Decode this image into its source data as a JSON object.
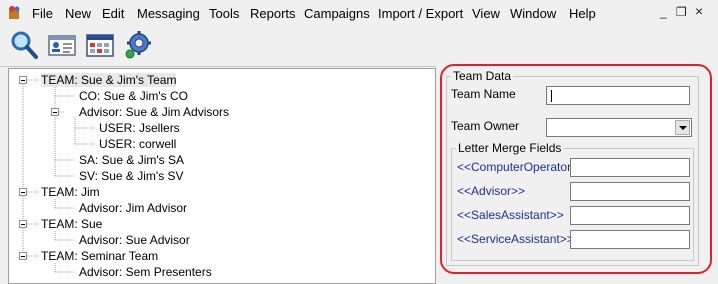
{
  "menubar": {
    "items": [
      "File",
      "New",
      "Edit",
      "Messaging",
      "Tools",
      "Reports",
      "Campaigns",
      "Import / Export",
      "View",
      "Window",
      "Help"
    ],
    "window_controls": {
      "minimize": "_",
      "restore": "❐",
      "close": "×"
    }
  },
  "toolbar": {
    "buttons": [
      "search-icon",
      "contact-card-icon",
      "calendar-grid-icon",
      "settings-gear-icon"
    ]
  },
  "tree": {
    "nodes": [
      {
        "label": "TEAM:  Sue & Jim's Team",
        "selected": true
      },
      {
        "label": "CO:  Sue & Jim's CO"
      },
      {
        "label": "Advisor:  Sue & Jim Advisors"
      },
      {
        "label": "USER:  Jsellers"
      },
      {
        "label": "USER:  corwell"
      },
      {
        "label": "SA:  Sue & Jim's SA"
      },
      {
        "label": "SV:  Sue & Jim's SV"
      },
      {
        "label": "TEAM:  Jim"
      },
      {
        "label": "Advisor:  Jim Advisor"
      },
      {
        "label": "TEAM:  Sue"
      },
      {
        "label": "Advisor:  Sue Advisor"
      },
      {
        "label": "TEAM:  Seminar Team"
      },
      {
        "label": "Advisor:  Sem Presenters"
      }
    ]
  },
  "team_data": {
    "title": "Team Data",
    "team_name_label": "Team Name",
    "team_name_value": "",
    "team_owner_label": "Team Owner",
    "team_owner_value": "",
    "merge_fields": {
      "title": "Letter Merge Fields",
      "fields": [
        {
          "label": "<<ComputerOperator>>",
          "value": ""
        },
        {
          "label": "<<Advisor>>",
          "value": ""
        },
        {
          "label": "<<SalesAssistant>>",
          "value": ""
        },
        {
          "label": "<<ServiceAssistant>>",
          "value": ""
        }
      ]
    }
  },
  "colors": {
    "highlight_ring": "#d9232e",
    "merge_label": "#1c2fa0"
  }
}
